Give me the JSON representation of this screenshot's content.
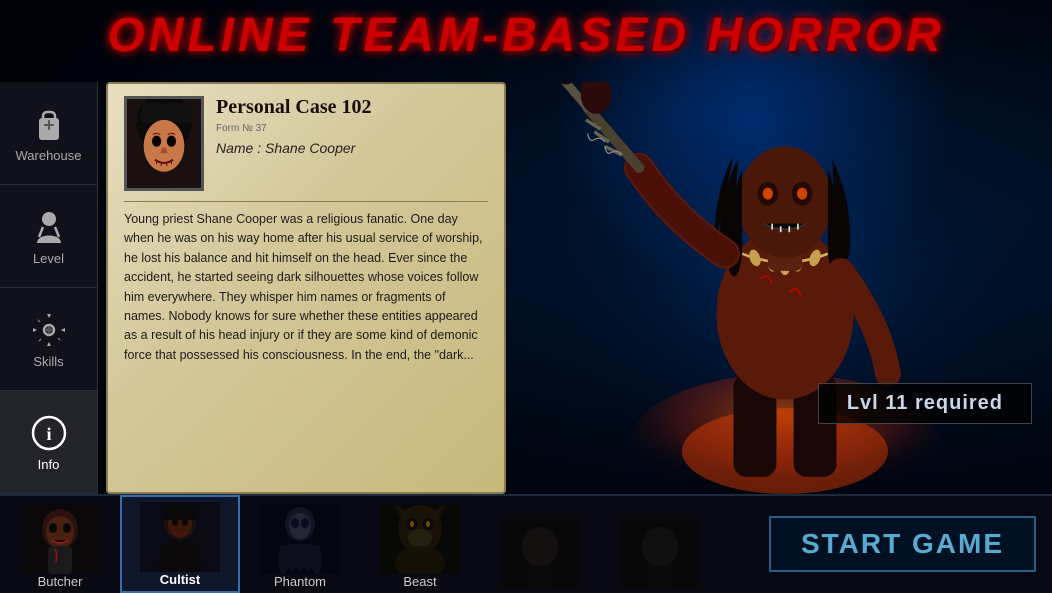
{
  "title": "ONLINE TEAM-BASED HORROR",
  "sidebar": {
    "items": [
      {
        "id": "warehouse",
        "label": "Warehouse",
        "icon": "backpack-icon",
        "active": false
      },
      {
        "id": "level",
        "label": "Level",
        "icon": "person-icon",
        "active": false
      },
      {
        "id": "skills",
        "label": "Skills",
        "icon": "gear-icon",
        "active": false
      },
      {
        "id": "info",
        "label": "Info",
        "icon": "info-icon",
        "active": true
      }
    ]
  },
  "case": {
    "title": "Personal Case 102",
    "form_number": "Form № 37",
    "name_label": "Name : Shane Cooper",
    "description": "Young priest Shane Cooper was a religious fanatic. One day when he was on his way home after his usual service of worship, he lost his balance and hit himself on the head. Ever since the accident, he started seeing dark silhouettes whose voices follow him everywhere. They whisper him names or fragments of names. Nobody knows for sure whether these entities appeared as a result of his head injury or if they are some kind of demonic force that possessed his consciousness. In the end, the \"dark..."
  },
  "monster": {
    "level_required": "Lvl 11 required"
  },
  "characters": [
    {
      "id": "butcher",
      "label": "Butcher",
      "active": false
    },
    {
      "id": "cultist",
      "label": "Cultist",
      "active": true
    },
    {
      "id": "phantom",
      "label": "Phantom",
      "active": false
    },
    {
      "id": "beast",
      "label": "Beast",
      "active": false
    },
    {
      "id": "slot5",
      "label": "",
      "active": false
    },
    {
      "id": "slot6",
      "label": "",
      "active": false
    }
  ],
  "start_button": "START GAME"
}
